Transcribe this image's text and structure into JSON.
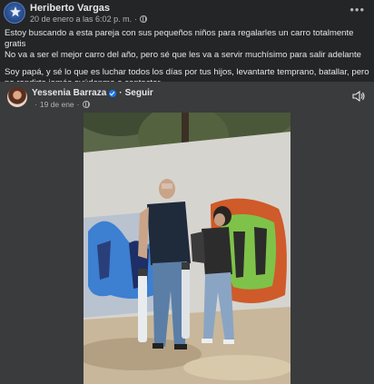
{
  "post": {
    "author": "Heriberto Vargas",
    "timestamp": "20 de enero a las 6:02 p. m.",
    "privacy_icon": "globe-icon",
    "more_icon": "more-options-icon",
    "text": {
      "line1": "Estoy buscando a esta pareja con sus pequeños niños para regalarles un carro totalmente gratis",
      "line2": "No va a ser el mejor carro del año, pero sé que les va a servir muchísimo para salir adelante",
      "line3": "Soy papá, y sé lo que es luchar todos los días por tus hijos, levantarte temprano, batallar, pero no rendirte jamás ayúdenme a contactar"
    }
  },
  "shared": {
    "author": "Yessenia Barraza",
    "separator": "·",
    "follow_label": "Seguir",
    "date": "19 de ene",
    "date_separator": "·",
    "volume_icon": "volume-icon"
  },
  "colors": {
    "background": "#242526",
    "card": "#3a3b3c",
    "text_primary": "#e4e6eb",
    "text_secondary": "#b0b3b8",
    "verified": "#1877f2"
  }
}
